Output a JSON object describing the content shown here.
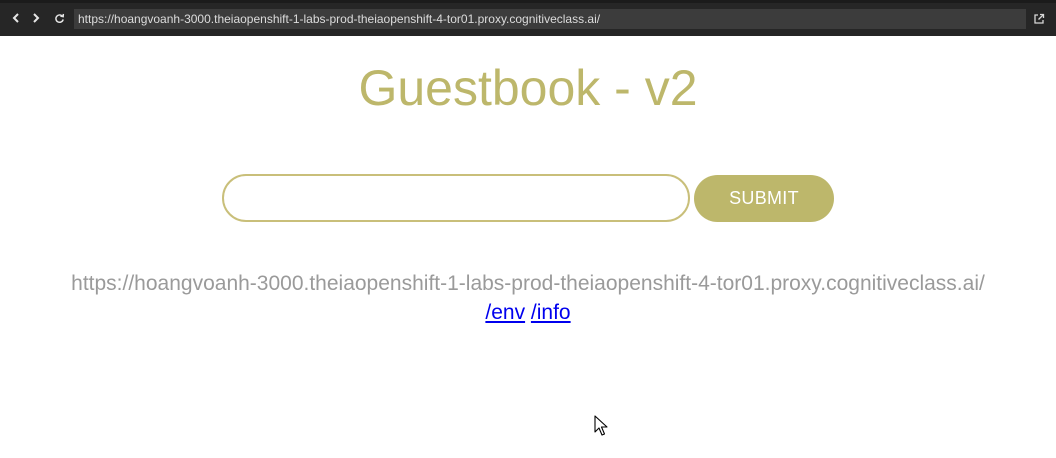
{
  "browser": {
    "url": "https://hoangvoanh-3000.theiaopenshift-1-labs-prod-theiaopenshift-4-tor01.proxy.cognitiveclass.ai/",
    "icons": [
      "back-icon",
      "forward-icon",
      "refresh-icon",
      "open-external-icon"
    ]
  },
  "page": {
    "title": "Guestbook - v2",
    "input": {
      "value": "",
      "placeholder": ""
    },
    "submit_label": "SUBMIT",
    "host_address": "https://hoangvoanh-3000.theiaopenshift-1-labs-prod-theiaopenshift-4-tor01.proxy.cognitiveclass.ai/",
    "links": {
      "env": "/env",
      "info": "/info"
    }
  },
  "colors": {
    "accent": "#bdb76b",
    "toolbar": "#262626",
    "link": "#0000ee",
    "host_text": "#9a9a9a"
  }
}
